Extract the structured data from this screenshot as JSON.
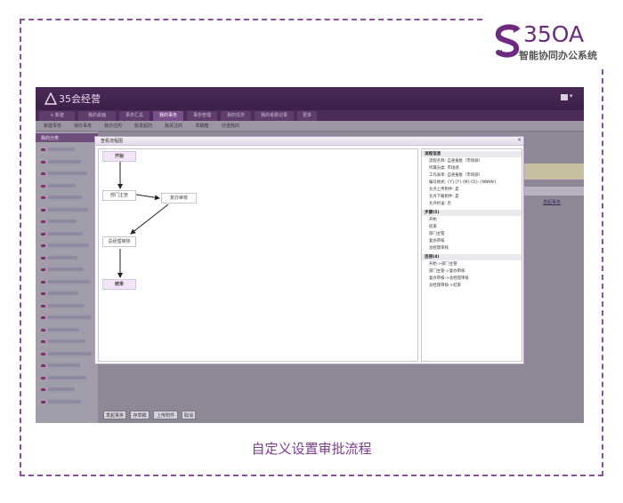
{
  "caption": "自定义设置审批流程",
  "logo": {
    "brand": "35OA",
    "sub": "智能协同办公系统"
  },
  "app": {
    "title": "35会经营",
    "nav_tabs": [
      "+ 新建",
      "我的桌面",
      "事务汇总",
      "我的事务",
      "事务管理",
      "我的任务",
      "我的考勤记录",
      "更多"
    ],
    "subnav": [
      "新建事务",
      "待办事务",
      "我办过的",
      "我发起的",
      "我关注的",
      "草稿箱",
      "抄送我的"
    ],
    "left_header": "我的分类",
    "right_link": "发起事务",
    "bottom_buttons": [
      "发起事务",
      "存草稿",
      "上传附件",
      "取消"
    ]
  },
  "dialog": {
    "title": "查看流程图",
    "close": "×",
    "nodes": {
      "start": "开始",
      "dept": "部门主管",
      "review": "复办审核",
      "gm": "总经理审核",
      "end": "结束"
    },
    "info": {
      "groups": [
        {
          "title": "流程信息",
          "lines": [
            "流程名称: 自查报批（市场部）",
            "所属分类: 市场部",
            "工作表单: 自查报批（市场部）",
            "编号格式: {Y}{Y}{M}{D}-{NNNN}",
            "允许上传附件: 是",
            "允许下载附件: 是",
            "允许抄送: 否"
          ]
        },
        {
          "title": "步骤(5)",
          "lines": [
            "开始",
            "结束",
            "部门主管",
            "复办审核",
            "总经理审核"
          ]
        },
        {
          "title": "连接(4)",
          "lines": [
            "开始->部门主管",
            "部门主管->复办审核",
            "复办审核->总经理审核",
            "总经理审核->结束"
          ]
        }
      ]
    }
  }
}
